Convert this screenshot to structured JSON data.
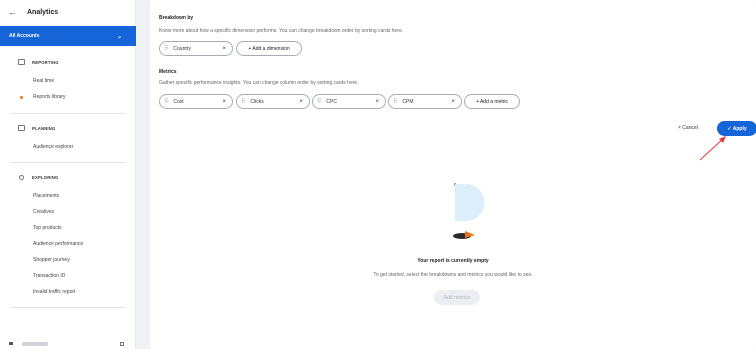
{
  "sidebar": {
    "back_icon": "arrow-left-icon",
    "title": "Analytics",
    "account": {
      "label": "All Accounts",
      "chevron": "⌄"
    },
    "reporting": {
      "title": "REPORTING",
      "items": [
        "Real time",
        "Reports library"
      ],
      "active": "Reports library"
    },
    "planning": {
      "title": "PLANNING",
      "items": [
        "Audience explorer"
      ]
    },
    "exploring": {
      "title": "EXPLORING",
      "items": [
        "Placements",
        "Creatives",
        "Top products",
        "Audience performance",
        "Shopper journey",
        "Transaction ID",
        "Invalid traffic report"
      ]
    }
  },
  "breakdown": {
    "title": "Breakdown by",
    "description": "Know more about how a specific dimension performs. You can change breakdown order by sorting cards here.",
    "chips": [
      "Country"
    ],
    "add_label": "+ Add a dimension"
  },
  "metrics": {
    "title": "Metrics",
    "description": "Gather specific performance insights. You can change column order by sorting cards here.",
    "chips": [
      "Cost",
      "Clicks",
      "CPC",
      "CPM"
    ],
    "add_label": "+ Add a metric"
  },
  "actions": {
    "cancel_label": "× Cancel",
    "apply_label": "✓ Apply"
  },
  "empty_state": {
    "title": "Your report is currently empty",
    "description": "To get started, select the breakdowns and metrics you would like to see.",
    "button_label": "Add metrics"
  },
  "colors": {
    "primary": "#1565d8",
    "accent_orange": "#e8731c",
    "annotation_red": "#e53935",
    "illustration_blue": "#dbeefa"
  }
}
